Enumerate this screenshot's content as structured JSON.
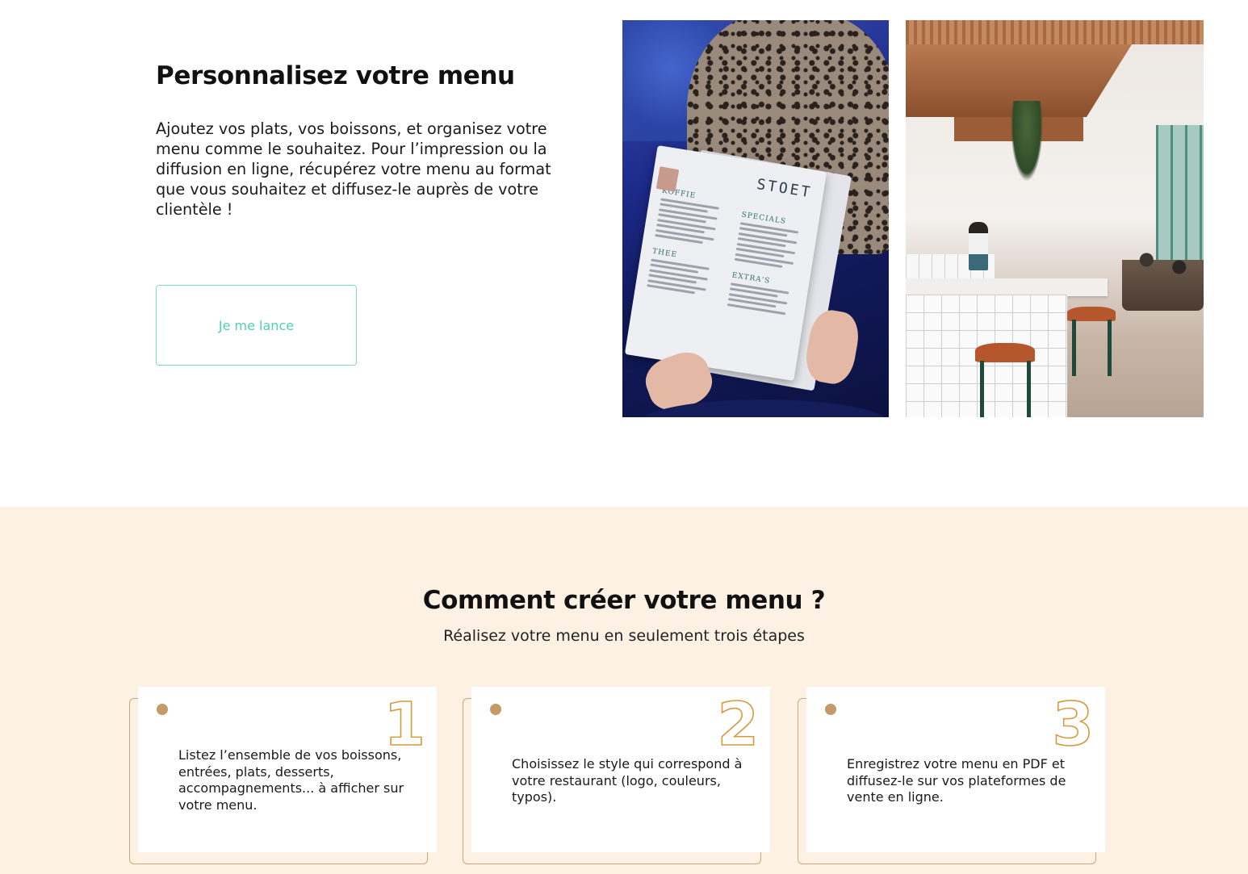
{
  "intro": {
    "title": "Personnalisez votre menu",
    "text": "Ajoutez vos plats, vos boissons, et organisez votre menu comme le souhaitez. Pour l’impression ou la diffusion en ligne, récupérez votre menu au format que vous souhaitez et diffusez-le auprès de votre clientèle !",
    "cta_label": "Je me lance"
  },
  "images": {
    "menu_card": {
      "brand": "STOET",
      "sections": [
        "KOFFIE",
        "SPECIALS",
        "THEE",
        "EXTRA'S"
      ]
    }
  },
  "steps_section": {
    "title": "Comment créer votre menu ?",
    "subtitle": "Réalisez votre menu en seulement trois étapes",
    "steps": [
      {
        "number": "1",
        "text": "Listez l’ensemble de vos boissons, entrées, plats, desserts, accompagnements... à afficher sur votre menu."
      },
      {
        "number": "2",
        "text": "Choisissez le style qui correspond à votre restaurant (logo, couleurs, typos)."
      },
      {
        "number": "3",
        "text": "Enregistrez votre menu en PDF et diffusez-le sur vos plateformes de vente en ligne."
      }
    ]
  },
  "colors": {
    "accent": "#4fd0ad",
    "section_bg": "#fdf1e4",
    "step_number_outline": "#d49b3f",
    "step_dot": "#c49a68"
  }
}
